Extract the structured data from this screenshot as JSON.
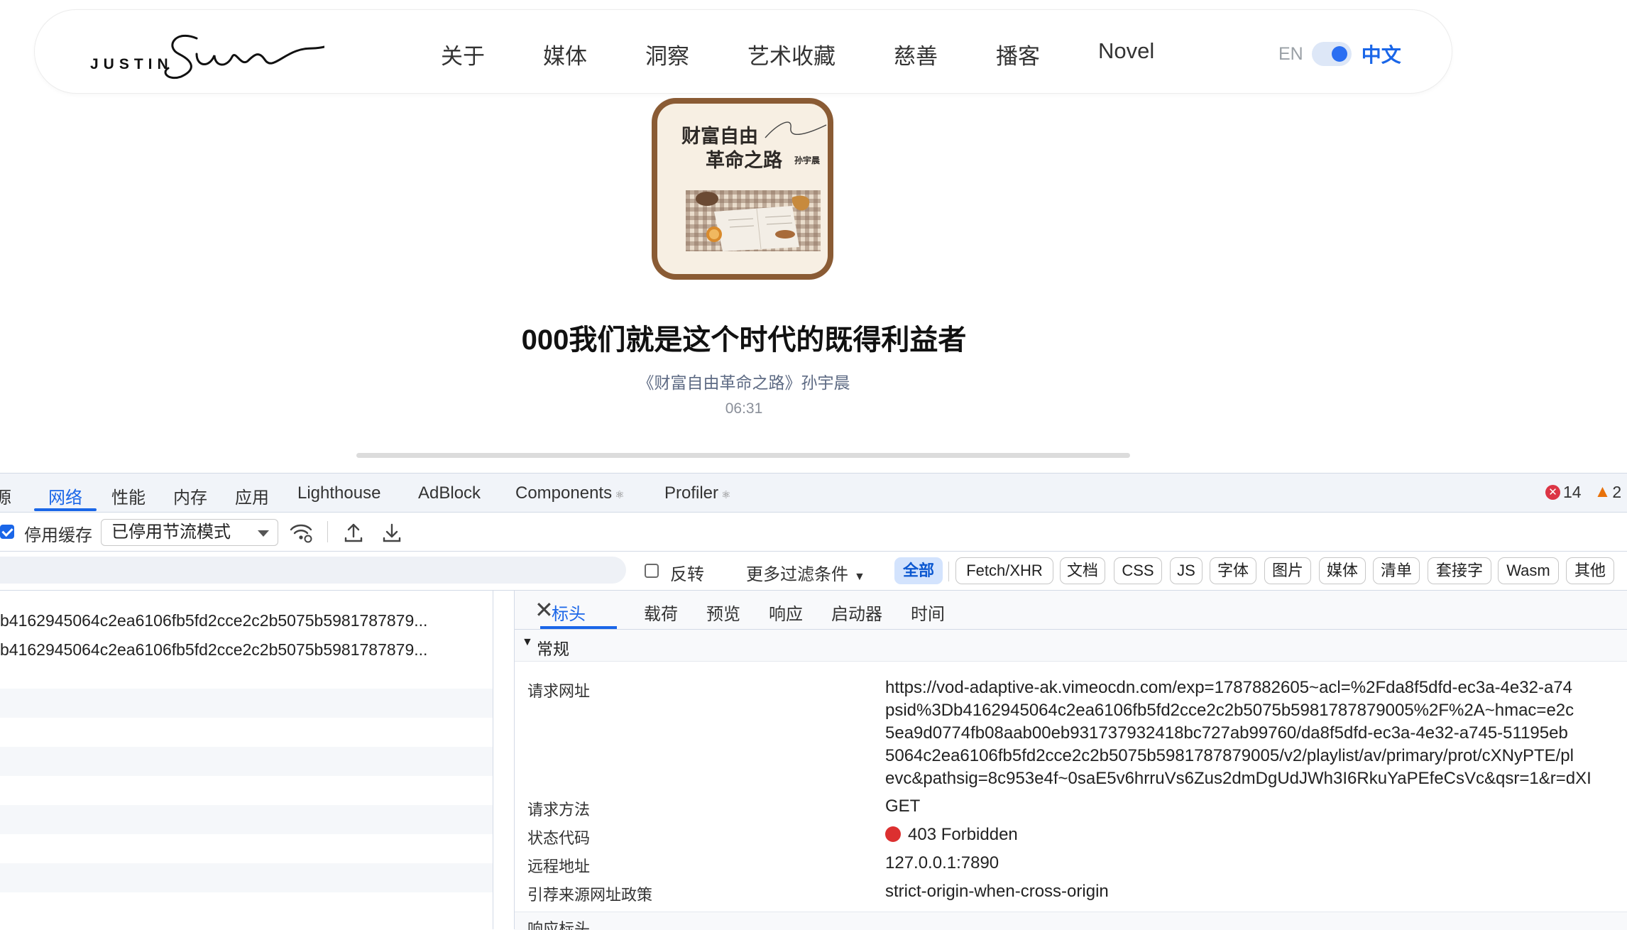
{
  "site": {
    "logo_text": "JUSTIN",
    "logo_script": "Sun",
    "nav": [
      "关于",
      "媒体",
      "洞察",
      "艺术收藏",
      "慈善",
      "播客",
      "Novel"
    ],
    "lang_en": "EN",
    "lang_zh": "中文"
  },
  "cover": {
    "title_line1": "财富自由",
    "title_line2": "革命之路",
    "author": "孙宇晨"
  },
  "episode": {
    "title": "000我们就是这个时代的既得利益者",
    "subtitle": "《财富自由革命之路》孙宇晨",
    "time": "06:31",
    "progress": 0
  },
  "devtools": {
    "tabs": [
      "源",
      "网络",
      "性能",
      "内存",
      "应用",
      "Lighthouse",
      "AdBlock",
      "Components",
      "Profiler"
    ],
    "active_tab": "网络",
    "errors": "14",
    "warnings": "2",
    "toolbar": {
      "disable_cache_label": "停用缓存",
      "disable_cache_checked": true,
      "throttle_value": "已停用节流模式"
    },
    "filter": {
      "invert_label": "反转",
      "more_filters": "更多过滤条件",
      "chips": [
        "全部",
        "Fetch/XHR",
        "文档",
        "CSS",
        "JS",
        "字体",
        "图片",
        "媒体",
        "清单",
        "套接字",
        "Wasm",
        "其他"
      ],
      "active_chip": "全部"
    },
    "requests": [
      "b4162945064c2ea6106fb5fd2cce2c2b5075b5981787879...",
      "b4162945064c2ea6106fb5fd2cce2c2b5075b5981787879..."
    ],
    "detail": {
      "tabs": [
        "标头",
        "载荷",
        "预览",
        "响应",
        "启动器",
        "时间"
      ],
      "active_tab": "标头",
      "section": "常规",
      "request_url_label": "请求网址",
      "request_url_lines": [
        "https://vod-adaptive-ak.vimeocdn.com/exp=1787882605~acl=%2Fda8f5dfd-ec3a-4e32-a74",
        "psid%3Db4162945064c2ea6106fb5fd2cce2c2b5075b5981787879005%2F%2A~hmac=e2c",
        "5ea9d0774fb08aab00eb931737932418bc727ab99760/da8f5dfd-ec3a-4e32-a745-51195eb",
        "5064c2ea6106fb5fd2cce2c2b5075b5981787879005/v2/playlist/av/primary/prot/cXNyPTE/pl",
        "evc&pathsig=8c953e4f~0saE5v6hrruVs6Zus2dmDgUdJWh3I6RkuYaPEfeCsVc&qsr=1&r=dXI"
      ],
      "method_label": "请求方法",
      "method": "GET",
      "status_label": "状态代码",
      "status": "403 Forbidden",
      "status_color": "#dc3030",
      "remote_label": "远程地址",
      "remote": "127.0.0.1:7890",
      "referrer_label": "引荐来源网址政策",
      "referrer": "strict-origin-when-cross-origin",
      "next_section": "响应标头"
    }
  },
  "colors": {
    "accent": "#1a66e8",
    "cover_frame": "#8a5b34",
    "error": "#dc3545",
    "warning": "#e8710a"
  }
}
